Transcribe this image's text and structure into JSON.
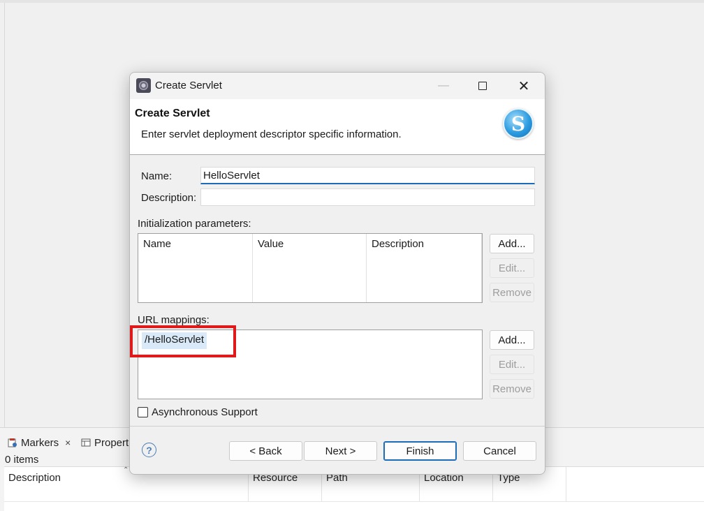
{
  "ide": {
    "bottom_tabs": [
      {
        "label": "Markers",
        "close": "×"
      },
      {
        "label": "Propert"
      }
    ],
    "item_count": "0 items",
    "columns": [
      "Description",
      "Resource",
      "Path",
      "Location",
      "Type"
    ]
  },
  "dialog": {
    "window_title": "Create Servlet",
    "header_title": "Create Servlet",
    "header_subtitle": "Enter servlet deployment descriptor specific information.",
    "logo_letter": "S",
    "name_label": "Name:",
    "name_value": "HelloServlet",
    "description_label": "Description:",
    "description_value": "",
    "init_params_label": "Initialization parameters:",
    "init_params_columns": [
      "Name",
      "Value",
      "Description"
    ],
    "init_buttons": {
      "add": "Add...",
      "edit": "Edit...",
      "remove": "Remove"
    },
    "url_mappings_label": "URL mappings:",
    "url_mappings": [
      "/HelloServlet"
    ],
    "url_buttons": {
      "add": "Add...",
      "edit": "Edit...",
      "remove": "Remove"
    },
    "async_label": "Asynchronous Support",
    "async_checked": false,
    "help": "?",
    "buttons": {
      "back": "< Back",
      "next": "Next >",
      "finish": "Finish",
      "cancel": "Cancel"
    },
    "highlight_color": "#e01a1a",
    "accent_color": "#1a6bb8"
  }
}
